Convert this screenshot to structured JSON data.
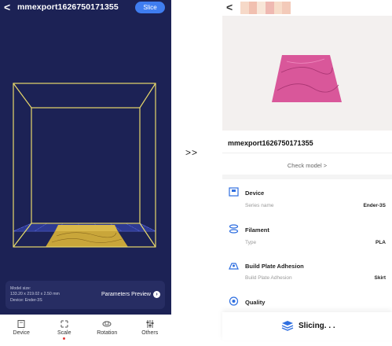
{
  "left_screen": {
    "header": {
      "back_glyph": "<",
      "title": "mmexport1626750171355",
      "slice_label": "Slice"
    },
    "info_panel": {
      "model_size_label": "Model size:",
      "dimensions": "133.20 x 219.02 x 2.50 mm",
      "device": "Device: Ender-3S",
      "parameters_preview_label": "Parameters Preview"
    },
    "bottom_nav": [
      {
        "label": "Device",
        "icon": "device-icon"
      },
      {
        "label": "Scale",
        "icon": "scale-icon",
        "active": true
      },
      {
        "label": "Rotation",
        "icon": "rotation-icon"
      },
      {
        "label": "Others",
        "icon": "sliders-icon"
      }
    ]
  },
  "arrow_text": ">>",
  "right_screen": {
    "header": {
      "back_glyph": "<"
    },
    "model_name": "mmexport1626750171355",
    "check_model_label": "Check model >",
    "sections": [
      {
        "title": "Device",
        "key": "Series name",
        "value": "Ender-3S",
        "icon": "device-icon"
      },
      {
        "title": "Filament",
        "key": "Type",
        "value": "PLA",
        "icon": "filament-spool-icon"
      },
      {
        "title": "Build Plate Adhesion",
        "key": "Build Plate Adhesion",
        "value": "Skirt",
        "icon": "adhesion-icon"
      },
      {
        "title": "Quality",
        "icon": "quality-icon"
      }
    ],
    "slicing_label": "Slicing. . ."
  },
  "colors": {
    "left_bg": "#1c2255",
    "slice_button": "#3f7df0",
    "box_outline": "#e8d86a",
    "print_bed": "#c9a63a",
    "model_pink": "#d9579a",
    "icon_blue": "#2f6fe0"
  }
}
